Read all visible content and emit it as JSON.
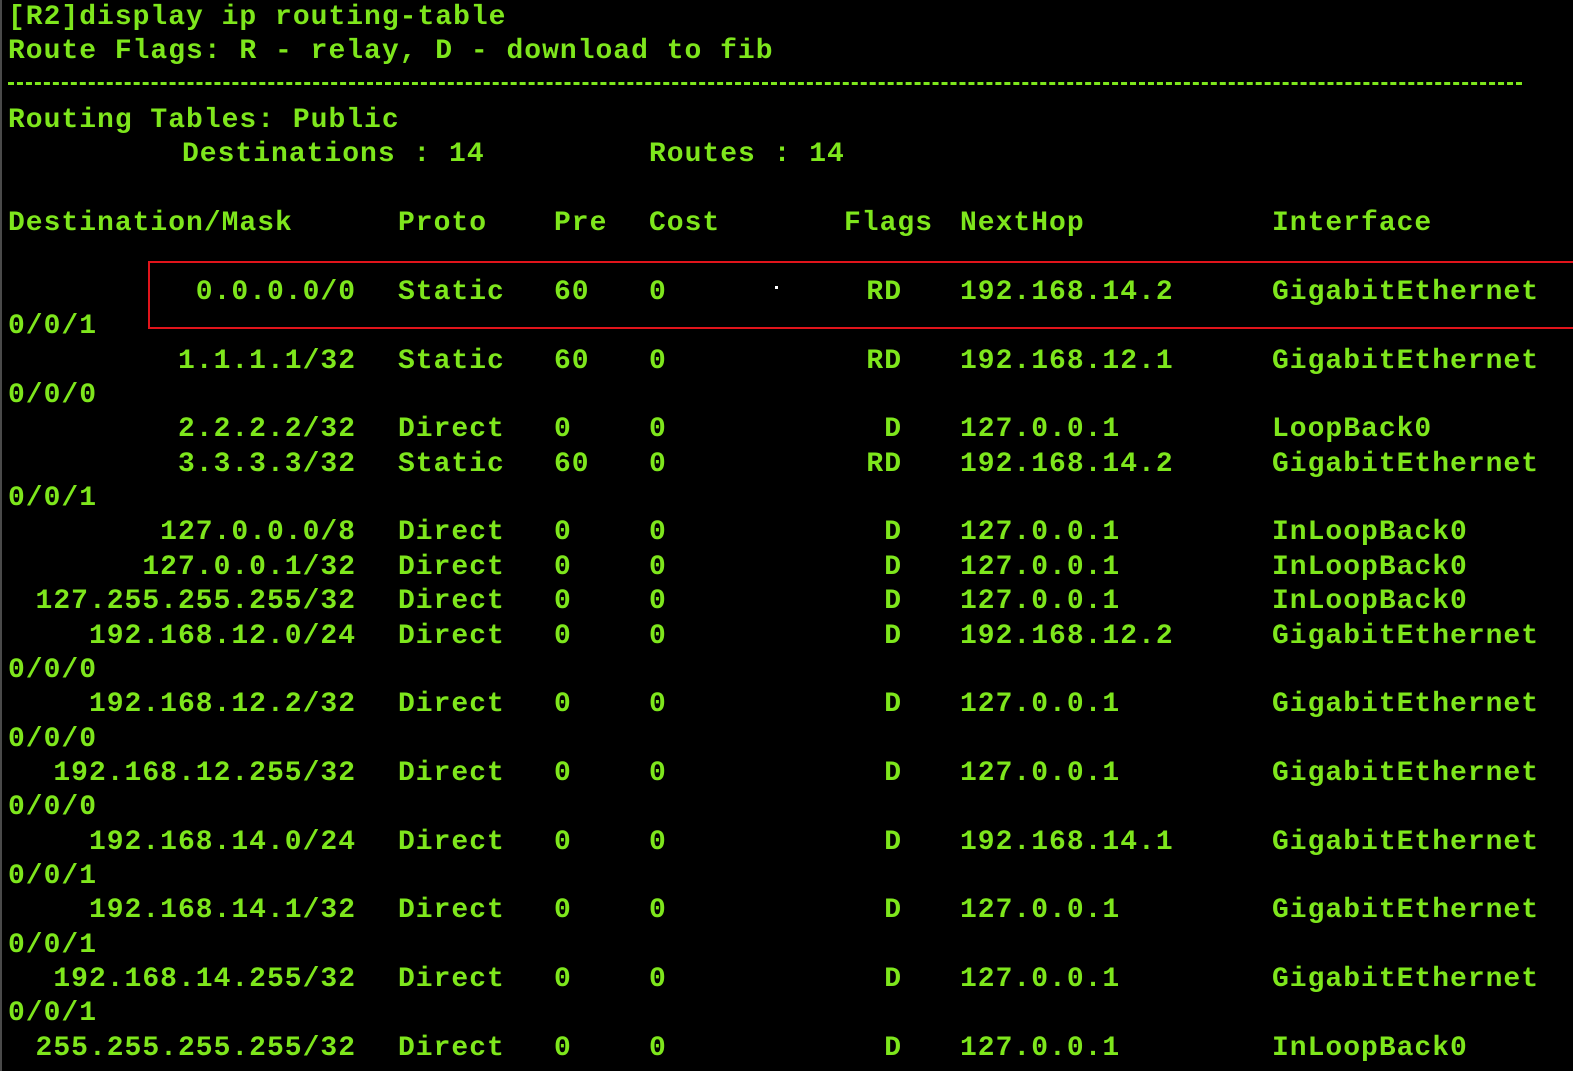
{
  "command_line": "[R2]display ip routing-table",
  "flags_line": "Route Flags: R - relay, D - download to fib",
  "divider": "------------------------------------------------------------------------------",
  "table_title": "Routing Tables: Public",
  "summary": {
    "destinations": "Destinations : 14",
    "routes": "Routes : 14"
  },
  "headers": {
    "destination": "Destination/Mask",
    "proto": "Proto",
    "pre": "Pre",
    "cost": "Cost",
    "flags": "Flags",
    "nexthop": "NextHop",
    "interface": "Interface"
  },
  "routes": [
    {
      "destination": "0.0.0.0/0",
      "proto": "Static",
      "pre": "60",
      "cost": "0",
      "flags": "RD",
      "nexthop": "192.168.14.2",
      "interface": "GigabitEthernet",
      "interface_cont": "0/0/1",
      "highlighted": true
    },
    {
      "destination": "1.1.1.1/32",
      "proto": "Static",
      "pre": "60",
      "cost": "0",
      "flags": "RD",
      "nexthop": "192.168.12.1",
      "interface": "GigabitEthernet",
      "interface_cont": "0/0/0"
    },
    {
      "destination": "2.2.2.2/32",
      "proto": "Direct",
      "pre": "0",
      "cost": "0",
      "flags": "D",
      "nexthop": "127.0.0.1",
      "interface": "LoopBack0"
    },
    {
      "destination": "3.3.3.3/32",
      "proto": "Static",
      "pre": "60",
      "cost": "0",
      "flags": "RD",
      "nexthop": "192.168.14.2",
      "interface": "GigabitEthernet",
      "interface_cont": "0/0/1"
    },
    {
      "destination": "127.0.0.0/8",
      "proto": "Direct",
      "pre": "0",
      "cost": "0",
      "flags": "D",
      "nexthop": "127.0.0.1",
      "interface": "InLoopBack0"
    },
    {
      "destination": "127.0.0.1/32",
      "proto": "Direct",
      "pre": "0",
      "cost": "0",
      "flags": "D",
      "nexthop": "127.0.0.1",
      "interface": "InLoopBack0"
    },
    {
      "destination": "127.255.255.255/32",
      "proto": "Direct",
      "pre": "0",
      "cost": "0",
      "flags": "D",
      "nexthop": "127.0.0.1",
      "interface": "InLoopBack0"
    },
    {
      "destination": "192.168.12.0/24",
      "proto": "Direct",
      "pre": "0",
      "cost": "0",
      "flags": "D",
      "nexthop": "192.168.12.2",
      "interface": "GigabitEthernet",
      "interface_cont": "0/0/0"
    },
    {
      "destination": "192.168.12.2/32",
      "proto": "Direct",
      "pre": "0",
      "cost": "0",
      "flags": "D",
      "nexthop": "127.0.0.1",
      "interface": "GigabitEthernet",
      "interface_cont": "0/0/0"
    },
    {
      "destination": "192.168.12.255/32",
      "proto": "Direct",
      "pre": "0",
      "cost": "0",
      "flags": "D",
      "nexthop": "127.0.0.1",
      "interface": "GigabitEthernet",
      "interface_cont": "0/0/0"
    },
    {
      "destination": "192.168.14.0/24",
      "proto": "Direct",
      "pre": "0",
      "cost": "0",
      "flags": "D",
      "nexthop": "192.168.14.1",
      "interface": "GigabitEthernet",
      "interface_cont": "0/0/1"
    },
    {
      "destination": "192.168.14.1/32",
      "proto": "Direct",
      "pre": "0",
      "cost": "0",
      "flags": "D",
      "nexthop": "127.0.0.1",
      "interface": "GigabitEthernet",
      "interface_cont": "0/0/1"
    },
    {
      "destination": "192.168.14.255/32",
      "proto": "Direct",
      "pre": "0",
      "cost": "0",
      "flags": "D",
      "nexthop": "127.0.0.1",
      "interface": "GigabitEthernet",
      "interface_cont": "0/0/1"
    },
    {
      "destination": "255.255.255.255/32",
      "proto": "Direct",
      "pre": "0",
      "cost": "0",
      "flags": "D",
      "nexthop": "127.0.0.1",
      "interface": "InLoopBack0"
    }
  ],
  "colors": {
    "background": "#000000",
    "text": "#7ee61c",
    "highlight_border": "#e1141b"
  }
}
